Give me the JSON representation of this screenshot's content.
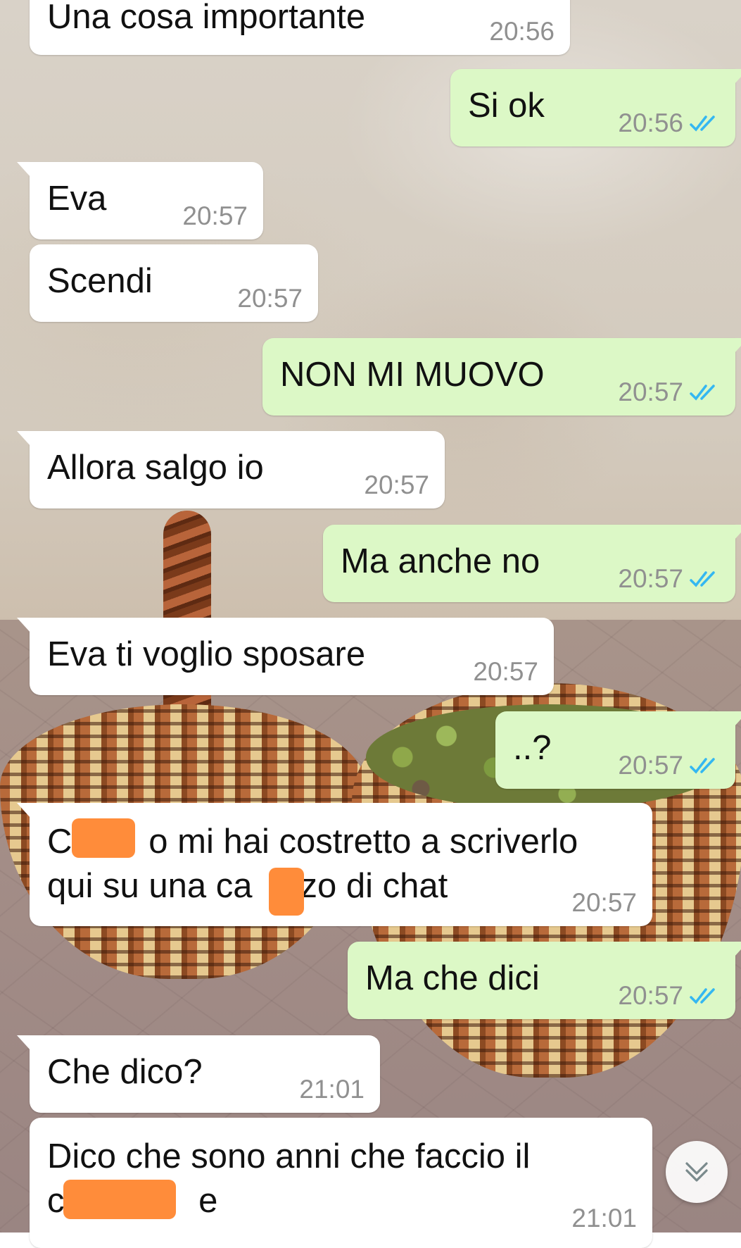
{
  "chat": {
    "messages": [
      {
        "direction": "in",
        "text": "Una cosa importante",
        "time": "20:56"
      },
      {
        "direction": "out",
        "text": "Si ok",
        "time": "20:56",
        "status": "read"
      },
      {
        "direction": "in",
        "text": "Eva",
        "time": "20:57"
      },
      {
        "direction": "in",
        "text": "Scendi",
        "time": "20:57"
      },
      {
        "direction": "out",
        "text": "NON MI MUOVO",
        "time": "20:57",
        "status": "read"
      },
      {
        "direction": "in",
        "text": "Allora salgo io",
        "time": "20:57"
      },
      {
        "direction": "out",
        "text": "Ma anche no",
        "time": "20:57",
        "status": "read"
      },
      {
        "direction": "in",
        "text": "Eva ti voglio sposare",
        "time": "20:57"
      },
      {
        "direction": "out",
        "text": "..?",
        "time": "20:57",
        "status": "read"
      },
      {
        "direction": "in",
        "lines": [
          "C        o mi hai costretto a scriverlo",
          "qui su una ca     zo di chat"
        ],
        "time": "20:57",
        "redacted": true
      },
      {
        "direction": "out",
        "text": "Ma che dici",
        "time": "20:57",
        "status": "read"
      },
      {
        "direction": "in",
        "text": "Che dico?",
        "time": "21:01"
      },
      {
        "direction": "in",
        "lines": [
          "Dico che sono anni che faccio il",
          "c              e"
        ],
        "time": "21:01",
        "redacted": true
      }
    ]
  },
  "colors": {
    "incoming_bubble": "#ffffff",
    "outgoing_bubble": "#dcf8c6",
    "read_ticks": "#34b7f1",
    "timestamp": "#909090",
    "redaction": "#ff8c3a"
  },
  "icons": {
    "read_receipt": "double-check-icon",
    "scroll_down": "chevron-double-down-icon"
  }
}
